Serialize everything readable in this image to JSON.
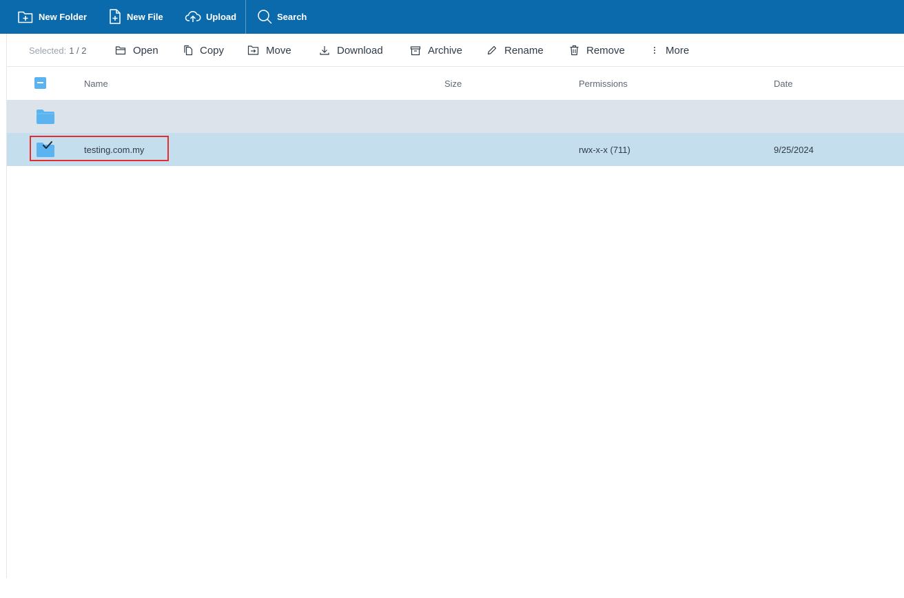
{
  "toolbar": {
    "new_folder": "New Folder",
    "new_file": "New File",
    "upload": "Upload",
    "search": "Search",
    "background": "#0b6aab"
  },
  "actions": {
    "selected_label": "Selected:",
    "selected_count": "1 / 2",
    "open": "Open",
    "copy": "Copy",
    "move": "Move",
    "download": "Download",
    "archive": "Archive",
    "rename": "Rename",
    "remove": "Remove",
    "more": "More"
  },
  "table": {
    "columns": {
      "name": "Name",
      "size": "Size",
      "permissions": "Permissions",
      "date": "Date"
    },
    "rows": [
      {
        "type": "parent-folder",
        "name": "",
        "size": "",
        "permissions": "",
        "date": "",
        "icon": "folder-icon"
      },
      {
        "type": "folder",
        "name": "testing.com.my",
        "size": "",
        "permissions": "rwx-x-x (711)",
        "date": "9/25/2024",
        "icon": "folder-checked-icon",
        "selected": true
      }
    ]
  },
  "colors": {
    "folder": "#5bb4ef",
    "parent_row": "#dde3eb",
    "selected_row": "#c5deee",
    "highlight": "#e52b2f"
  }
}
